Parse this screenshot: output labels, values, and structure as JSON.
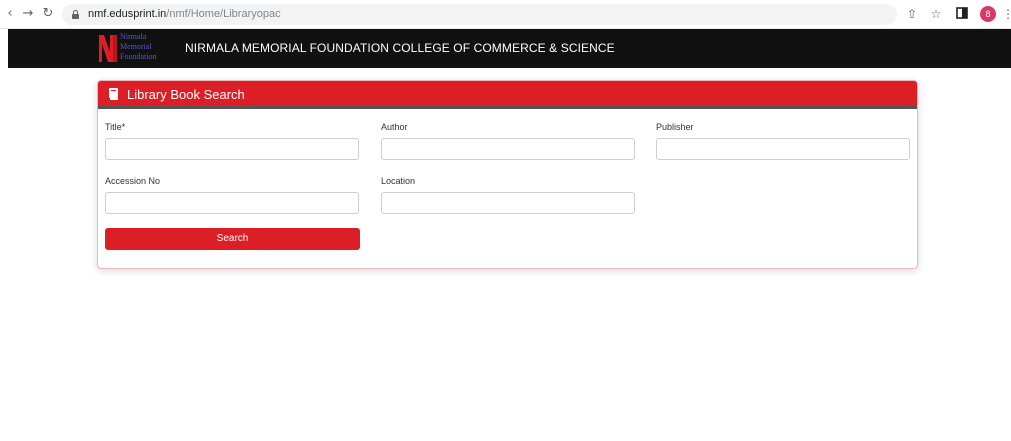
{
  "browser": {
    "url_host": "nmf.edusprint.in",
    "url_path": "/nmf/Home/Libraryopac",
    "profile_initial": "8"
  },
  "header": {
    "logo_text": [
      "Nirmala",
      "Memorial",
      "Foundation"
    ],
    "college_name": "NIRMALA MEMORIAL FOUNDATION COLLEGE OF COMMERCE & SCIENCE"
  },
  "search_card": {
    "title": "Library Book Search",
    "fields": {
      "title": {
        "label": "Title*",
        "value": ""
      },
      "author": {
        "label": "Author",
        "value": ""
      },
      "publisher": {
        "label": "Publisher",
        "value": ""
      },
      "accession_no": {
        "label": "Accession No",
        "value": ""
      },
      "location": {
        "label": "Location",
        "value": ""
      }
    },
    "search_button": "Search"
  },
  "colors": {
    "accent": "#dc1f26",
    "header_bg": "#111111",
    "logo_text": "#5b55c9"
  },
  "icons": {
    "back": "arrow-left-icon",
    "forward": "arrow-right-icon",
    "reload": "reload-icon",
    "lock": "lock-icon",
    "share": "share-icon",
    "bookmark": "star-icon",
    "sidebar": "sidebar-icon",
    "menu": "more-vert-icon",
    "card": "book-icon"
  }
}
